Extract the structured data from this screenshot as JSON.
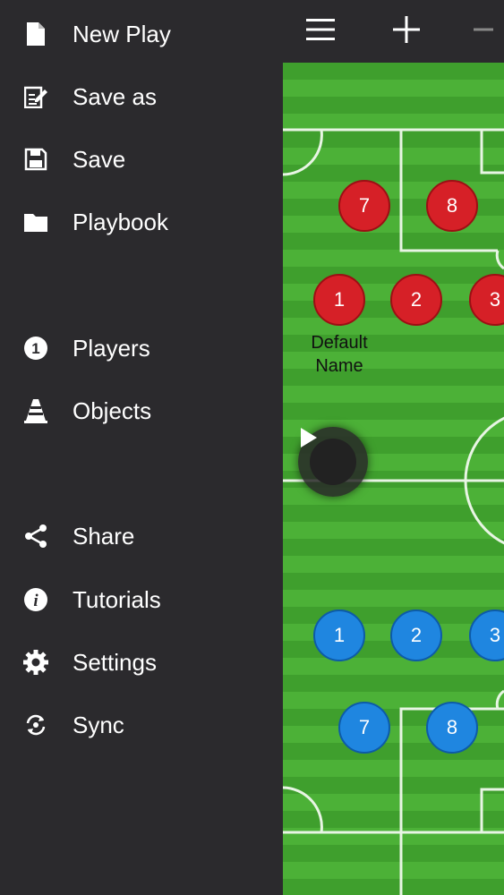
{
  "menu": {
    "items": [
      {
        "label": "New Play",
        "icon": "document-icon"
      },
      {
        "label": "Save as",
        "icon": "edit-document-icon"
      },
      {
        "label": "Save",
        "icon": "floppy-disk-icon"
      },
      {
        "label": "Playbook",
        "icon": "folder-icon"
      },
      {
        "label": "Players",
        "icon": "number-one-circle-icon"
      },
      {
        "label": "Objects",
        "icon": "cone-icon"
      },
      {
        "label": "Share",
        "icon": "share-icon"
      },
      {
        "label": "Tutorials",
        "icon": "info-icon"
      },
      {
        "label": "Settings",
        "icon": "gear-icon"
      },
      {
        "label": "Sync",
        "icon": "sync-icon"
      }
    ]
  },
  "toolbar": {
    "menu_icon": "hamburger-icon",
    "add_icon": "plus-icon",
    "zoom_out_icon": "minus-icon"
  },
  "field": {
    "red_players": [
      "7",
      "8",
      "1",
      "2",
      "3"
    ],
    "blue_players": [
      "1",
      "2",
      "3",
      "7",
      "8"
    ],
    "player_name_line1": "Default",
    "player_name_line2": "Name"
  },
  "colors": {
    "red_team": "#d62027",
    "blue_team": "#1f86e0",
    "pitch": "#45a832",
    "sidebar": "#2b2a2d"
  }
}
